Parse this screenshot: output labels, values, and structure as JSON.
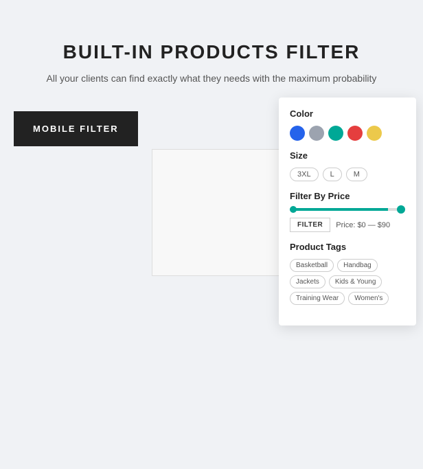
{
  "page": {
    "title": "BUILT-IN PRODUCTS FILTER",
    "subtitle": "All your clients can find exactly what they needs with the maximum probability",
    "background_color": "#f0f2f5"
  },
  "mobile_filter_button": {
    "label": "MOBILE FILTER"
  },
  "filter_card": {
    "color_section": {
      "title": "Color",
      "swatches": [
        {
          "color": "#2563eb",
          "name": "blue"
        },
        {
          "color": "#9ca3af",
          "name": "gray"
        },
        {
          "color": "#00a896",
          "name": "teal"
        },
        {
          "color": "#e53e3e",
          "name": "red"
        },
        {
          "color": "#ecc94b",
          "name": "yellow"
        }
      ]
    },
    "size_section": {
      "title": "Size",
      "options": [
        "3XL",
        "L",
        "M"
      ]
    },
    "price_section": {
      "title": "Filter By Price",
      "min": 0,
      "max": 90,
      "filter_button_label": "FILTER",
      "price_text": "Price: $0 — $90"
    },
    "tags_section": {
      "title": "Product Tags",
      "tags": [
        "Basketball",
        "Handbag",
        "Jackets",
        "Kids & Young",
        "Training Wear",
        "Women's"
      ]
    }
  }
}
